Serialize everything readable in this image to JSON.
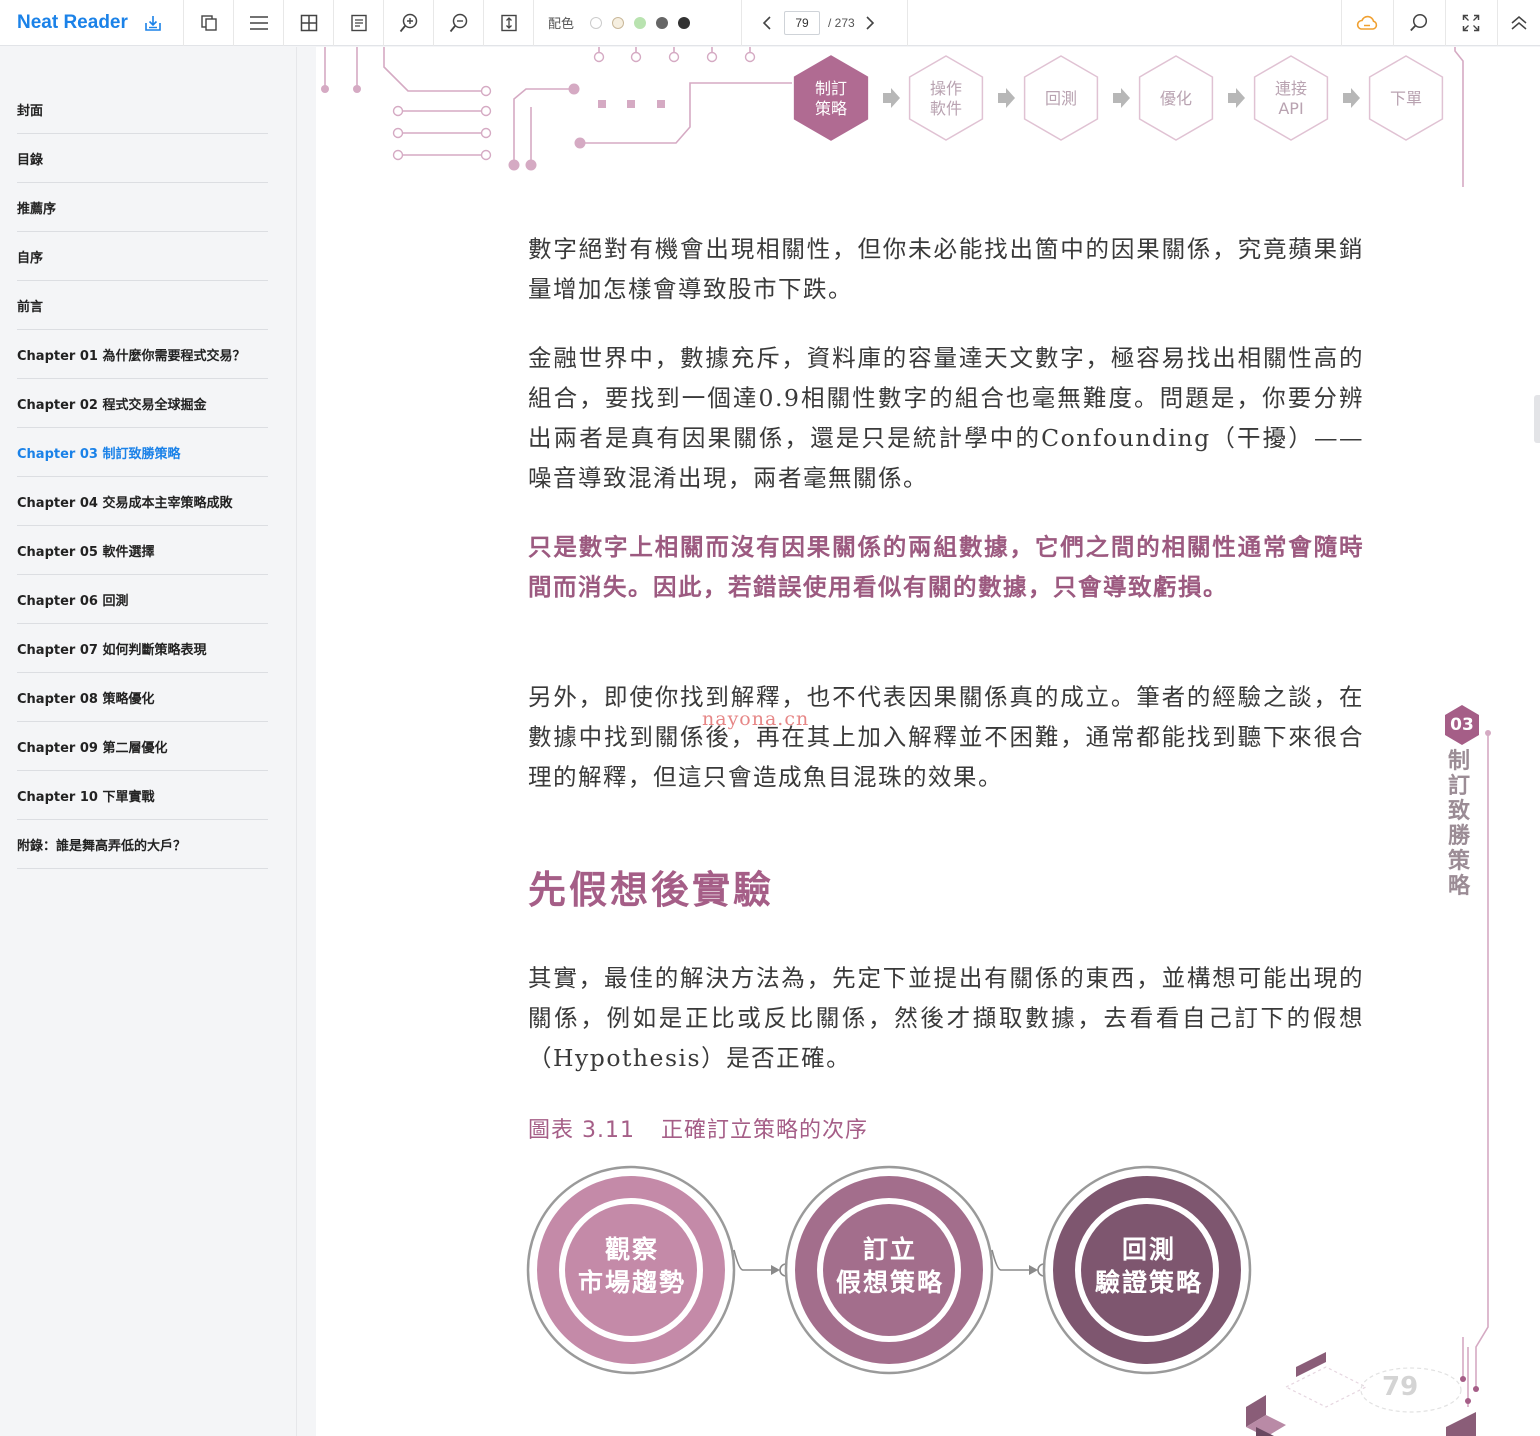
{
  "app": {
    "name": "Neat Reader"
  },
  "toolbar": {
    "color_label": "配色",
    "color_swatches": [
      "#ffffff",
      "#f3ead8",
      "#b9e3b0",
      "#666666",
      "#333333"
    ],
    "current_page": "79",
    "total_pages": "/ 273"
  },
  "toc": [
    {
      "label": "封面",
      "active": false
    },
    {
      "label": "目錄",
      "active": false
    },
    {
      "label": "推薦序",
      "active": false
    },
    {
      "label": "自序",
      "active": false
    },
    {
      "label": "前言",
      "active": false
    },
    {
      "label": "Chapter 01 為什麼你需要程式交易？",
      "active": false
    },
    {
      "label": "Chapter 02 程式交易全球掘金",
      "active": false
    },
    {
      "label": "Chapter 03 制訂致勝策略",
      "active": true
    },
    {
      "label": "Chapter 04 交易成本主宰策略成敗",
      "active": false
    },
    {
      "label": "Chapter 05 軟件選擇",
      "active": false
    },
    {
      "label": "Chapter 06 回測",
      "active": false
    },
    {
      "label": "Chapter 07 如何判斷策略表現",
      "active": false
    },
    {
      "label": "Chapter 08 策略優化",
      "active": false
    },
    {
      "label": "Chapter 09 第二層優化",
      "active": false
    },
    {
      "label": "Chapter 10 下單實戰",
      "active": false
    },
    {
      "label": "附錄：誰是舞高弄低的大戶？",
      "active": false
    }
  ],
  "page": {
    "flow_steps": [
      {
        "line1": "制訂",
        "line2": "策略",
        "active": true
      },
      {
        "line1": "操作",
        "line2": "軟件",
        "active": false
      },
      {
        "line1": "回測",
        "line2": "",
        "active": false
      },
      {
        "line1": "優化",
        "line2": "",
        "active": false
      },
      {
        "line1": "連接",
        "line2": "API",
        "active": false
      },
      {
        "line1": "下單",
        "line2": "",
        "active": false
      }
    ],
    "p1": "數字絕對有機會出現相關性，但你未必能找出箇中的因果關係，究竟蘋果銷量增加怎樣會導致股市下跌。",
    "p2": "金融世界中，數據充斥，資料庫的容量達天文數字，極容易找出相關性高的組合，要找到一個達0.9相關性數字的組合也毫無難度。問題是，你要分辨出兩者是真有因果關係，還是只是統計學中的Confounding（干擾）——噪音導致混淆出現，兩者毫無關係。",
    "p3": "只是數字上相關而沒有因果關係的兩組數據，它們之間的相關性通常會隨時間而消失。因此，若錯誤使用看似有關的數據，只會導致虧損。",
    "p4": "另外，即使你找到解釋，也不代表因果關係真的成立。筆者的經驗之談，在數據中找到關係後，再在其上加入解釋並不困難，通常都能找到聽下來很合理的解釋，但這只會造成魚目混珠的效果。",
    "watermark": "nayona.cn",
    "heading": "先假想後實驗",
    "p5": "其實，最佳的解決方法為，先定下並提出有關係的東西，並構想可能出現的關係，例如是正比或反比關係，然後才擷取數據，去看看自己訂下的假想（Hypothesis）是否正確。",
    "figure_number": "圖表 3.11",
    "figure_title": "正確訂立策略的次序",
    "figure_steps": [
      {
        "line1": "觀察",
        "line2": "市場趨勢",
        "color": "#c48aa8"
      },
      {
        "line1": "訂立",
        "line2": "假想策略",
        "color": "#a36e8c"
      },
      {
        "line1": "回測",
        "line2": "驗證策略",
        "color": "#7e566f"
      }
    ],
    "chapter_number": "03",
    "chapter_vertical_title": "制訂致勝策略",
    "page_number": "79"
  }
}
